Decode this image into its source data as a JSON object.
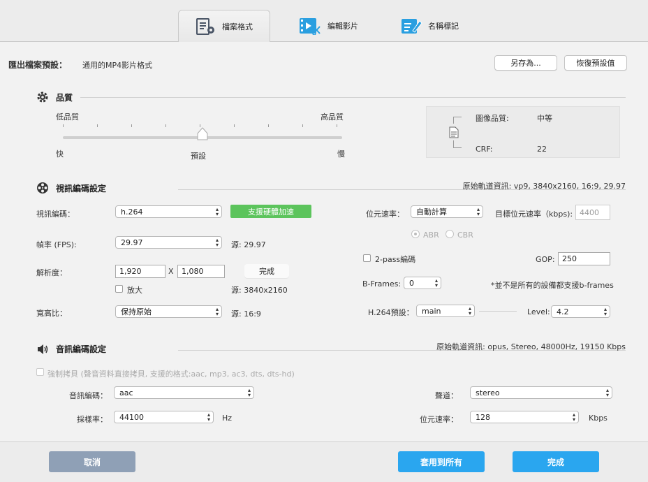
{
  "tabs": [
    {
      "label": "檔案格式",
      "icon": "file-settings-icon"
    },
    {
      "label": "編輯影片",
      "icon": "video-edit-icon"
    },
    {
      "label": "名稱標記",
      "icon": "name-tag-icon"
    }
  ],
  "preset": {
    "label": "匯出檔案預設：",
    "value": "通用的MP4影片格式",
    "save_as": "另存為...",
    "restore": "恢復預設值"
  },
  "quality": {
    "title": "品質",
    "low": "低品質",
    "high": "高品質",
    "fast": "快",
    "default": "預設",
    "slow": "慢",
    "level": 0.5,
    "info_image_label": "圖像品質:",
    "info_image_value": "中等",
    "info_crf_label": "CRF:",
    "info_crf_value": "22"
  },
  "video": {
    "title": "視訊編碼設定",
    "source_info": "原始軌道資訊: vp9, 3840x2160, 16:9, 29.97",
    "codec_label": "視訊編碼：",
    "codec_value": "h.264",
    "hw_accel": "支援硬體加速",
    "fps_label": "幀率 (FPS):",
    "fps_value": "29.97",
    "fps_src": "源: 29.97",
    "res_label": "解析度：",
    "res_w": "1,920",
    "res_x": "X",
    "res_h": "1,080",
    "res_done": "完成",
    "zoom_label": "放大",
    "res_src": "源: 3840x2160",
    "aspect_label": "寬高比：",
    "aspect_value": "保持原始",
    "aspect_src": "源: 16:9",
    "bitrate_label": "位元速率：",
    "bitrate_value": "自動計算",
    "target_bitrate_label": "目標位元速率（kbps):",
    "target_bitrate_placeholder": "4400",
    "abr": "ABR",
    "cbr": "CBR",
    "twopass_label": "2-pass編碼",
    "gop_label": "GOP:",
    "gop_value": "250",
    "bframes_label": "B-Frames:",
    "bframes_value": "0",
    "bframes_note": "*並不是所有的設備都支援b-frames",
    "h264_preset_label": "H.264預設：",
    "h264_preset_value": "main",
    "level_label": "Level:",
    "level_value": "4.2"
  },
  "audio": {
    "title": "音訊編碼設定",
    "source_info": "原始軌道資訊: opus, Stereo, 48000Hz, 19150 Kbps",
    "copy_label": "強制拷貝 (聲音資料直接拷貝, 支援的格式:aac, mp3, ac3, dts, dts-hd)",
    "codec_label": "音訊編碼：",
    "codec_value": "aac",
    "samplerate_label": "採樣率：",
    "samplerate_value": "44100",
    "samplerate_unit": "Hz",
    "channel_label": "聲道：",
    "channel_value": "stereo",
    "bitrate_label": "位元速率：",
    "bitrate_value": "128",
    "bitrate_unit": "Kbps"
  },
  "footer": {
    "cancel": "取消",
    "apply_all": "套用到所有",
    "done": "完成"
  },
  "colors": {
    "green": "#5cc45c",
    "blue": "#2aa6ef",
    "cancel": "#8fa0b6"
  }
}
